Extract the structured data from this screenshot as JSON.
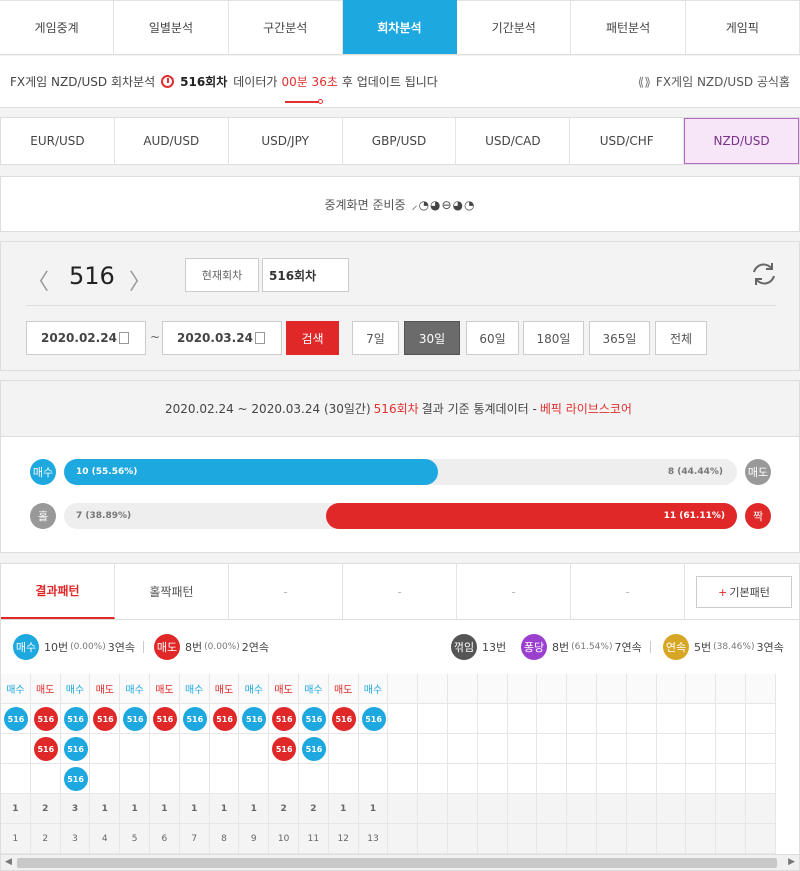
{
  "nav": {
    "tabs": [
      "게임중계",
      "일별분석",
      "구간분석",
      "회차분석",
      "기간분석",
      "패턴분석",
      "게임픽"
    ],
    "active": 3
  },
  "info": {
    "prefix": "FX게임 NZD/USD 회차분석",
    "round": "516회차",
    "mid": "데이터가",
    "countdown": "00분 36초",
    "suffix": "후 업데이트 됩니다",
    "official_link": "FX게임 NZD/USD 공식홈"
  },
  "currencies": {
    "items": [
      "EUR/USD",
      "AUD/USD",
      "USD/JPY",
      "GBP/USD",
      "USD/CAD",
      "USD/CHF",
      "NZD/USD"
    ],
    "active": 6
  },
  "prep": {
    "message": "중계화면 준비중",
    "spinner": "⸝◔◕⊖◕◔"
  },
  "round_panel": {
    "prev": "〈",
    "number": "516",
    "next": "〉",
    "current_label": "현재회차",
    "round_value": "516회차",
    "date_from": "2020.02.24",
    "tilde": "~",
    "date_to": "2020.03.24",
    "search": "검색",
    "periods": [
      "7일",
      "30일",
      "60일",
      "180일",
      "365일",
      "전체"
    ],
    "active_period": 1
  },
  "stats": {
    "range": "2020.02.24 ~ 2020.03.24 (30일간)",
    "round": "516회차",
    "mid": "결과 기준 통계데이터 -",
    "source": "베픽 라이브스코어",
    "row1": {
      "left_label": "매수",
      "left_text": "10 (55.56%)",
      "left_pct": 55.56,
      "right_text": "8 (44.44%)",
      "right_label": "매도"
    },
    "row2": {
      "left_label": "홀",
      "left_text": "7 (38.89%)",
      "right_pct": 61.11,
      "right_text": "11 (61.11%)",
      "right_label": "짝"
    },
    "colors": {
      "buy": "#1ea8e0",
      "sell": "#e02828",
      "odd": "#999999",
      "even": "#e02828"
    }
  },
  "pattern": {
    "tabs": [
      "결과패턴",
      "홀짝패턴",
      "-",
      "-",
      "-",
      "-"
    ],
    "basic_plus": "+",
    "basic_label": "기본패턴",
    "legend": {
      "buy": {
        "label": "매수",
        "count": "10번",
        "pct": "(0.00%)",
        "streak": "3연속"
      },
      "sell": {
        "label": "매도",
        "count": "8번",
        "pct": "(0.00%)",
        "streak": "2연속"
      },
      "break": {
        "label": "꺾임",
        "count": "13번"
      },
      "pong": {
        "label": "퐁당",
        "count": "8번",
        "pct": "(61.54%)",
        "streak": "7연속"
      },
      "cont": {
        "label": "연속",
        "count": "5번",
        "pct": "(38.46%)",
        "streak": "3연속"
      }
    },
    "ball_label": "516",
    "columns": [
      {
        "type": "매수",
        "kind": "b",
        "n": 1
      },
      {
        "type": "매도",
        "kind": "s",
        "n": 2
      },
      {
        "type": "매수",
        "kind": "b",
        "n": 3
      },
      {
        "type": "매도",
        "kind": "s",
        "n": 1
      },
      {
        "type": "매수",
        "kind": "b",
        "n": 1
      },
      {
        "type": "매도",
        "kind": "s",
        "n": 1
      },
      {
        "type": "매수",
        "kind": "b",
        "n": 1
      },
      {
        "type": "매도",
        "kind": "s",
        "n": 1
      },
      {
        "type": "매수",
        "kind": "b",
        "n": 1
      },
      {
        "type": "매도",
        "kind": "s",
        "n": 2
      },
      {
        "type": "매수",
        "kind": "b",
        "n": 2
      },
      {
        "type": "매도",
        "kind": "s",
        "n": 1
      },
      {
        "type": "매수",
        "kind": "b",
        "n": 1
      }
    ],
    "total_columns": 26
  }
}
